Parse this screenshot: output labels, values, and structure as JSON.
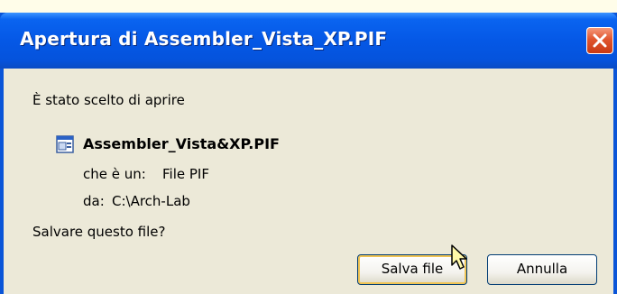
{
  "window": {
    "title": "Apertura di Assembler_Vista_XP.PIF"
  },
  "content": {
    "intro": "È stato scelto di aprire",
    "file_name": "Assembler_Vista&XP.PIF",
    "type_label": "che è un:",
    "type_value": "File PIF",
    "from_label": "da:",
    "from_value": "C:\\Arch-Lab",
    "question": "Salvare questo file?"
  },
  "buttons": {
    "save": "Salva file",
    "cancel": "Annulla"
  },
  "icons": {
    "file": "pif-file-icon",
    "close": "close-icon",
    "cursor": "mouse-cursor-icon"
  },
  "colors": {
    "titlebar": "#0558e6",
    "dialog_body": "#ece9d8",
    "close_button": "#e0552e"
  }
}
